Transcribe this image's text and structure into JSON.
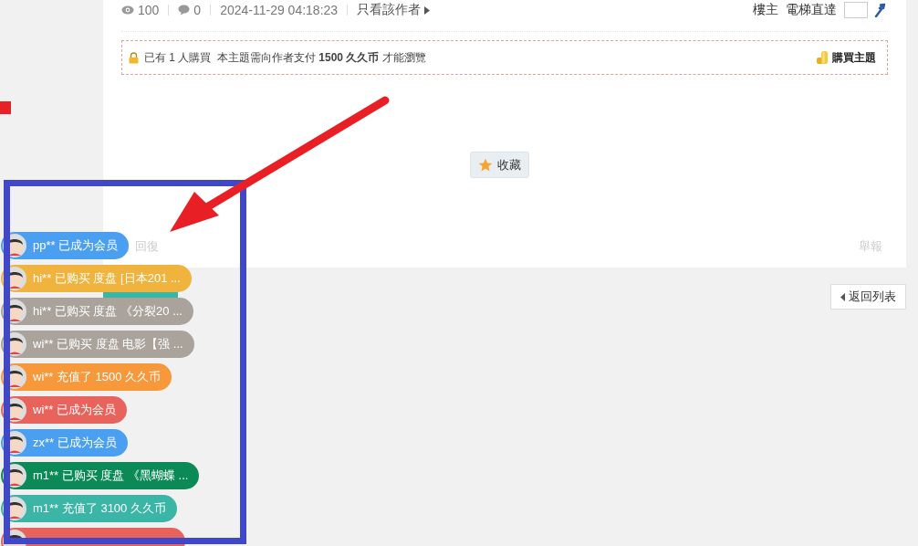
{
  "post_meta": {
    "views": "100",
    "replies": "0",
    "date": "2024-11-29 04:18:23",
    "author_only": "只看該作者",
    "floor": "樓主",
    "jump_label": "電梯直達"
  },
  "paywall": {
    "text": "已有 1 人購買  本主題需向作者支付 **1500 久久币** 才能瀏覽",
    "buy": "購買主題"
  },
  "favorite": "收藏",
  "reply": "回復",
  "report": "舉報",
  "back": "返回列表",
  "toasts": [
    {
      "text": "pp** 已成为会员",
      "color": "#4a9ff0"
    },
    {
      "text": "hi** 已购买 度盘 [日本201 ...",
      "color": "#f0b43e"
    },
    {
      "text": "hi** 已购买 度盘 《分裂20 ...",
      "color": "#a9a39c"
    },
    {
      "text": "wi** 已购买 度盘 电影【强 ...",
      "color": "#a9a39c"
    },
    {
      "text": "wi** 充值了 1500 久久币",
      "color": "#f7983a"
    },
    {
      "text": "wi** 已成为会员",
      "color": "#e8635c"
    },
    {
      "text": "zx** 已成为会员",
      "color": "#4a9ff0"
    },
    {
      "text": "m1** 已购买 度盘 《黑蝴蝶 ...",
      "color": "#0b8a57"
    },
    {
      "text": "m1** 充值了 3100 久久币",
      "color": "#3bb5a5"
    },
    {
      "color": "#e8635c"
    }
  ]
}
